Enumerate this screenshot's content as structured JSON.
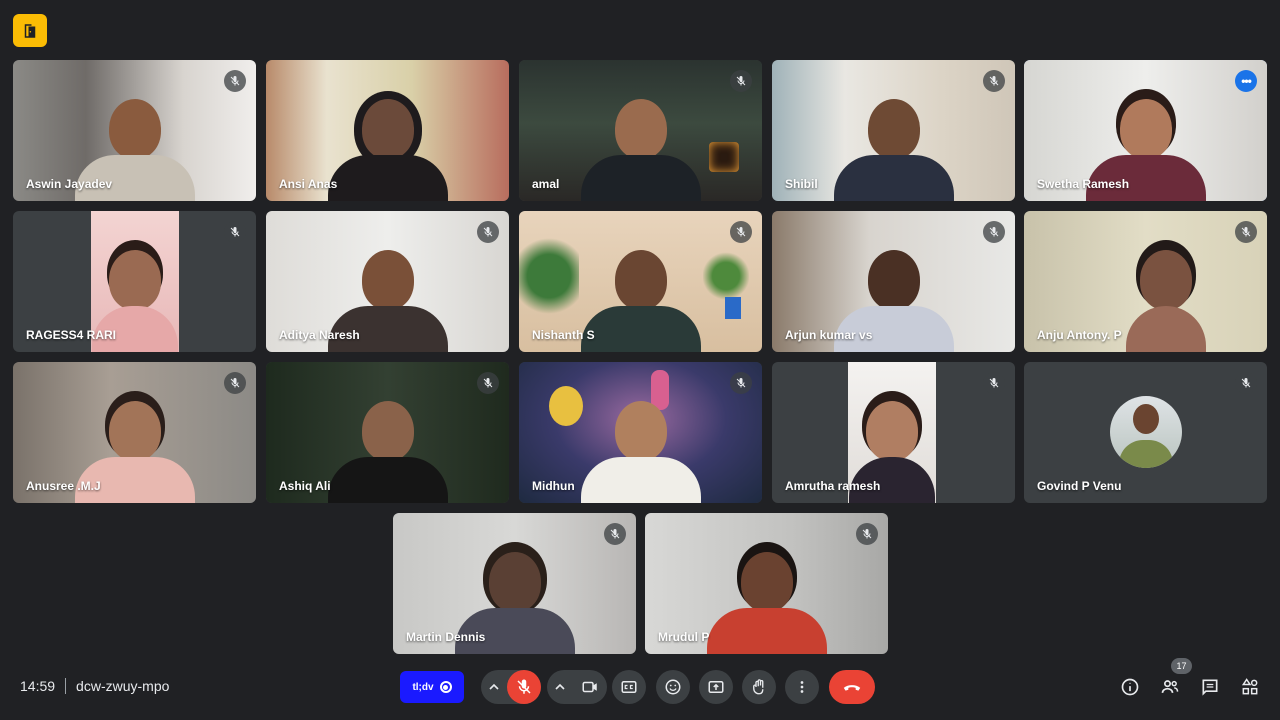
{
  "meeting": {
    "time": "14:59",
    "code": "dcw-zwuy-mpo",
    "participant_count": "17"
  },
  "extension": {
    "label": "tl;dv"
  },
  "participants": [
    {
      "name": "Aswin Jayadev"
    },
    {
      "name": "Ansi Anas"
    },
    {
      "name": "amal"
    },
    {
      "name": "Shibil"
    },
    {
      "name": "Swetha Ramesh"
    },
    {
      "name": "RAGESS4 RARI"
    },
    {
      "name": "Aditya Naresh"
    },
    {
      "name": "Nishanth S"
    },
    {
      "name": "Arjun kumar vs"
    },
    {
      "name": "Anju Antony. P"
    },
    {
      "name": "Anusree .M.J"
    },
    {
      "name": "Ashiq Ali"
    },
    {
      "name": "Midhun"
    },
    {
      "name": "Amrutha ramesh"
    },
    {
      "name": "Govind P Venu"
    },
    {
      "name": "Martin Dennis"
    },
    {
      "name": "Mrudul P"
    }
  ],
  "icons": {
    "mic_muted": "mic-off-icon",
    "more": "more-options-icon",
    "camera": "camera-icon",
    "captions": "captions-icon",
    "emoji": "emoji-icon",
    "present": "present-icon",
    "hand": "raise-hand-icon",
    "more_vert": "more-vert-icon",
    "hangup": "hangup-icon",
    "info": "info-icon",
    "people": "people-icon",
    "chat": "chat-icon",
    "activities": "activities-icon"
  },
  "colors": {
    "background": "#202124",
    "tile": "#3c4043",
    "danger": "#ea4335",
    "accent": "#1a73e8",
    "brand": "#fbbc04"
  }
}
